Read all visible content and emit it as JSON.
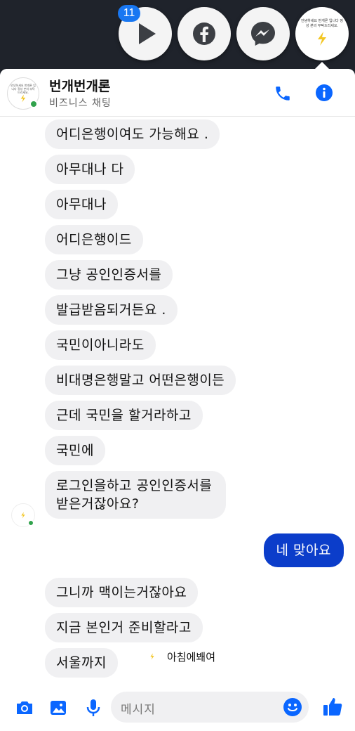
{
  "chat_heads": {
    "badge_count": "11",
    "biz_preview_text": "안녕하세요 번개론 입니다 정성 본의 부탁드리세요."
  },
  "header": {
    "name": "번개번개론",
    "subtitle": "비즈니스 채팅",
    "avatar_text": "안녕하세요 번개론 입니다 정성 본의 부탁드리세요."
  },
  "messages": [
    {
      "text": "어디은행이여도 가능해요 .",
      "sender": "other"
    },
    {
      "text": "아무대나 다",
      "sender": "other"
    },
    {
      "text": "아무대나",
      "sender": "other"
    },
    {
      "text": "어디은행이드",
      "sender": "other"
    },
    {
      "text": "그냥 공인인증서를",
      "sender": "other"
    },
    {
      "text": "발급받음되거든요 .",
      "sender": "other"
    },
    {
      "text": "국민이아니라도",
      "sender": "other"
    },
    {
      "text": "비대명은행말고 어떤은행이든",
      "sender": "other"
    },
    {
      "text": "근데 국민을 할거라하고",
      "sender": "other"
    },
    {
      "text": "국민에",
      "sender": "other"
    },
    {
      "text": "로그인을하고 공인인증서를 받은거잖아요?",
      "sender": "other"
    },
    {
      "text": "네 맞아요",
      "sender": "me"
    },
    {
      "text": "그니까 맥이는거잖아요",
      "sender": "other"
    },
    {
      "text": "지금 본인거 준비할라고",
      "sender": "other"
    },
    {
      "text": "서울까지",
      "sender": "other"
    }
  ],
  "typing_preview": {
    "text": "아침에봬여"
  },
  "composer": {
    "placeholder": "메시지"
  },
  "colors": {
    "accent": "#0b3dca",
    "messenger_blue": "#1877f2",
    "bubble_gray": "#f0f0f2"
  }
}
